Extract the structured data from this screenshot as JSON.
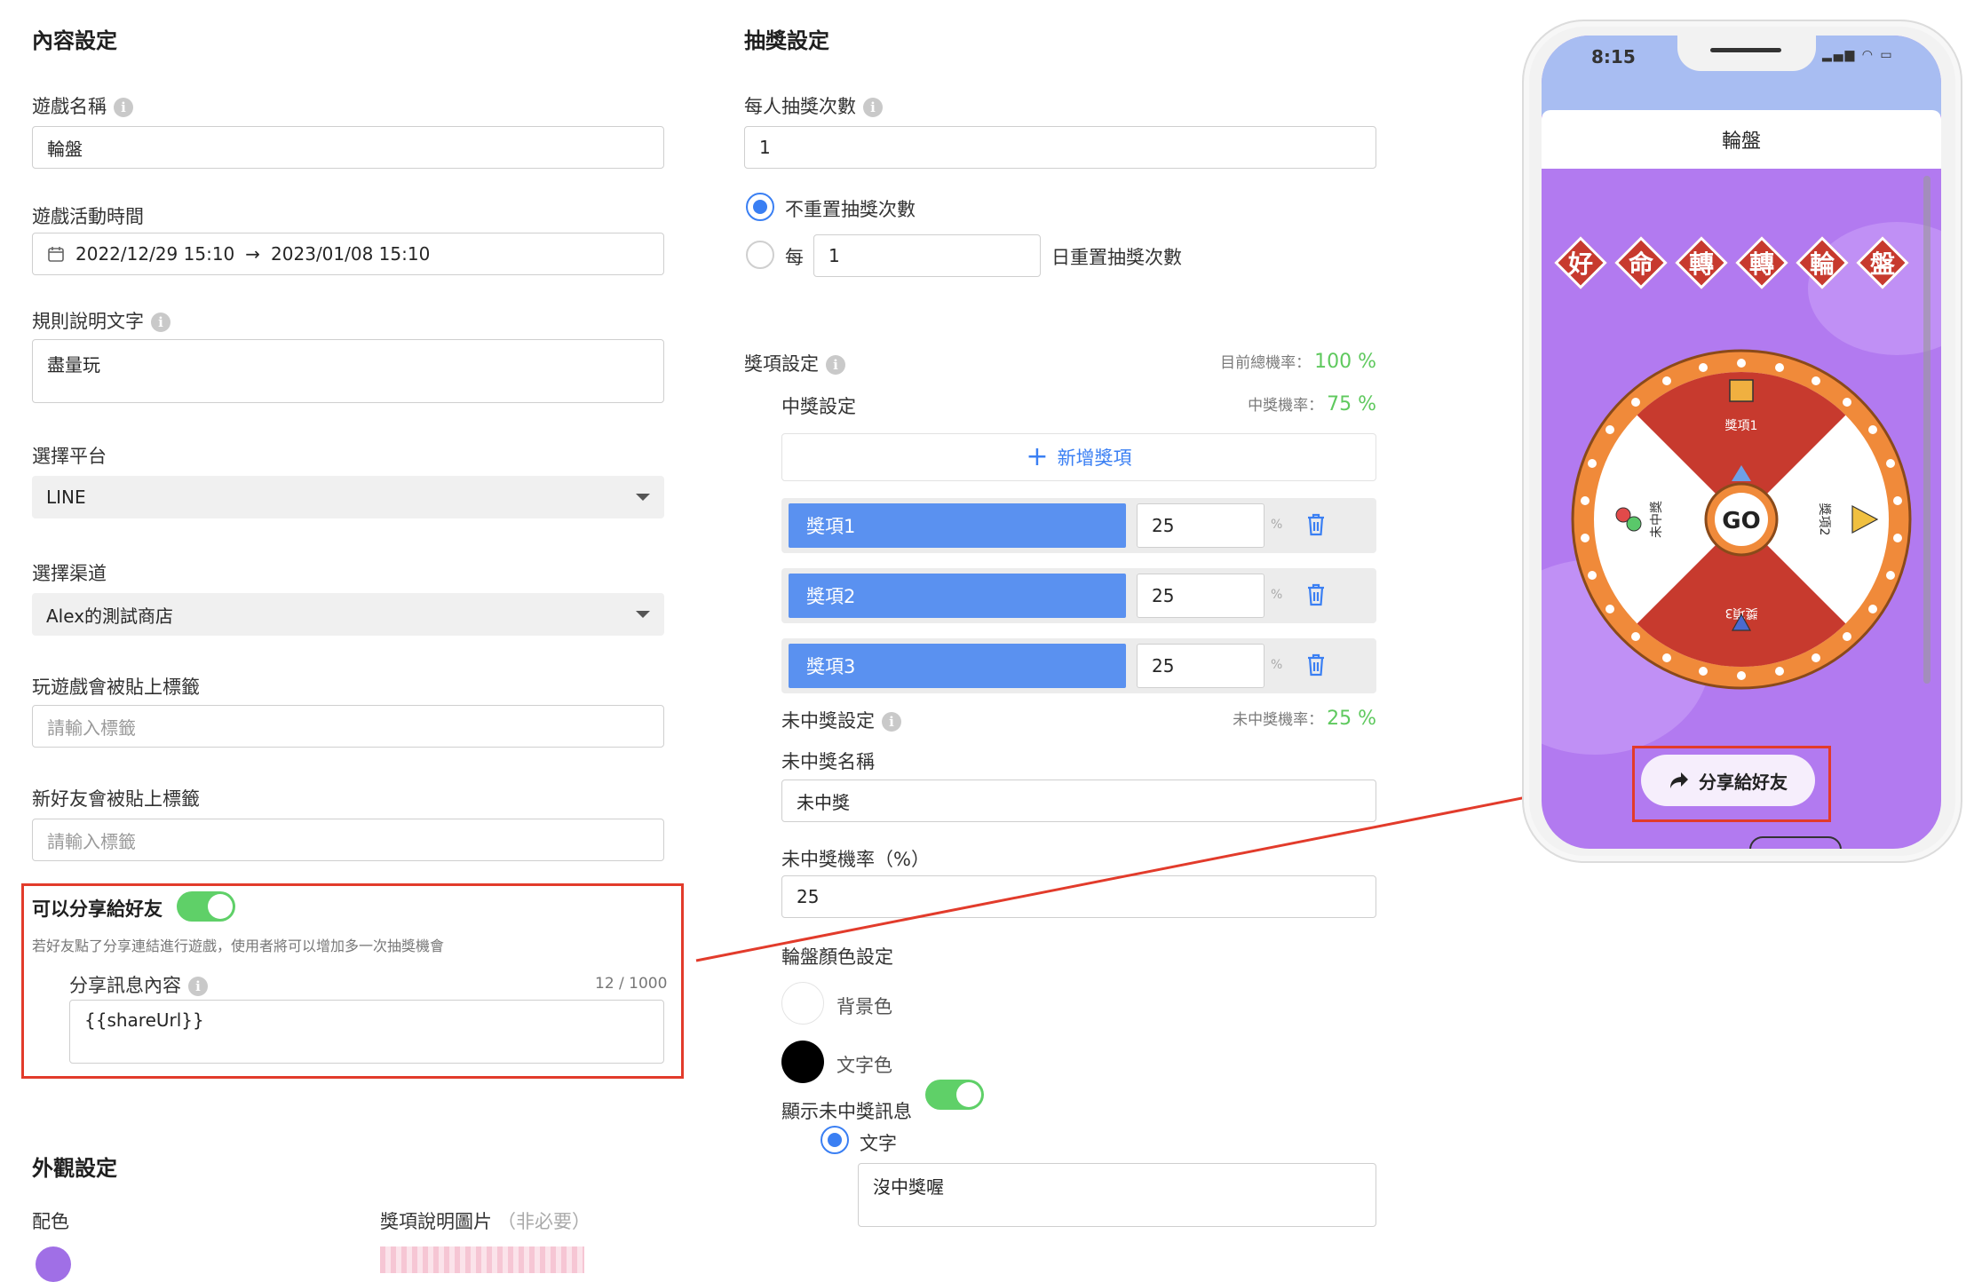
{
  "content": {
    "title": "內容設定",
    "game_name_label": "遊戲名稱",
    "game_name_value": "輪盤",
    "time_label": "遊戲活動時間",
    "time_start": "2022/12/29 15:10",
    "time_arrow": "→",
    "time_end": "2023/01/08 15:10",
    "rules_label": "規則說明文字",
    "rules_value": "盡量玩",
    "platform_label": "選擇平台",
    "platform_value": "LINE",
    "channel_label": "選擇渠道",
    "channel_value": "Alex的測試商店",
    "play_tag_label": "玩遊戲會被貼上標籤",
    "play_tag_placeholder": "請輸入標籤",
    "friend_tag_label": "新好友會被貼上標籤",
    "friend_tag_placeholder": "請輸入標籤",
    "share_label": "可以分享給好友",
    "share_on": true,
    "share_desc": "若好友點了分享連結進行遊戲，使用者將可以增加多一次抽獎機會",
    "share_msg_label": "分享訊息內容",
    "share_msg_count": "12 / 1000",
    "share_msg_value": "{{shareUrl}}"
  },
  "appearance": {
    "title": "外觀設定",
    "color_label": "配色",
    "prize_image_label": "獎項說明圖片",
    "prize_image_optional": "（非必要）"
  },
  "lottery": {
    "title": "抽獎設定",
    "draws_label": "每人抽獎次數",
    "draws_value": "1",
    "no_reset_label": "不重置抽獎次數",
    "every_label": "每",
    "every_days": "1",
    "reset_suffix": "日重置抽獎次數",
    "prize_settings_label": "獎項設定",
    "total_rate_label": "目前總機率：",
    "total_rate_value": "100 %",
    "win_settings_label": "中獎設定",
    "win_rate_label": "中獎機率：",
    "win_rate_value": "75 %",
    "add_prize_label": "新增獎項",
    "prizes": [
      {
        "name": "獎項1",
        "rate": "25"
      },
      {
        "name": "獎項2",
        "rate": "25"
      },
      {
        "name": "獎項3",
        "rate": "25"
      }
    ],
    "percent_sign": "%",
    "lose_settings_label": "未中獎設定",
    "lose_rate_label": "未中獎機率：",
    "lose_rate_value": "25 %",
    "lose_name_label": "未中獎名稱",
    "lose_name_value": "未中獎",
    "lose_prob_label": "未中獎機率（%）",
    "lose_prob_value": "25",
    "wheel_color_label": "輪盤顏色設定",
    "bg_color_label": "背景色",
    "text_color_label": "文字色",
    "bg_color": "#ffffff",
    "text_color": "#000000",
    "show_lose_label": "顯示未中獎訊息",
    "show_lose_on": true,
    "text_option_label": "文字",
    "lose_msg_value": "沒中獎喔"
  },
  "phone": {
    "time": "8:15",
    "header_title": "輪盤",
    "banner_chars": [
      "好",
      "命",
      "轉",
      "轉",
      "輪",
      "盤"
    ],
    "wheel_labels": [
      "獎項1",
      "獎項2",
      "獎項3",
      "未中獎"
    ],
    "go_label": "GO",
    "share_button_label": "分享給好友"
  },
  "colors": {
    "accent_blue": "#3a7ff3",
    "prize_blue": "#5a91f0",
    "toggle_green": "#5fd068",
    "rate_green": "#5fc95e",
    "annotation_red": "#e23b2b",
    "phone_purple": "#b27af0",
    "wheel_red": "#c73a2e",
    "wheel_orange": "#f08a3a"
  }
}
